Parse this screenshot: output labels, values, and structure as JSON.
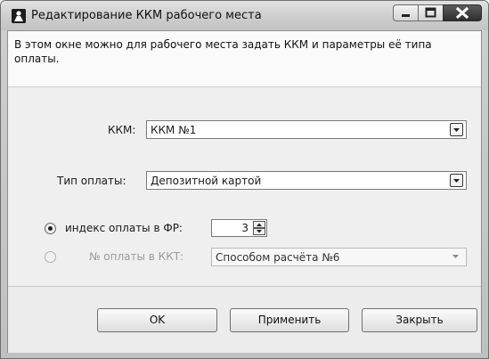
{
  "window": {
    "title": "Редактирование ККМ рабочего места",
    "icon": "app-icon"
  },
  "info": {
    "text": "В этом окне можно для рабочего места задать ККМ и параметры её типа оплаты."
  },
  "form": {
    "kkm_label": "ККМ:",
    "kkm_value": "ККМ №1",
    "payment_type_label": "Тип оплаты:",
    "payment_type_value": "Депозитной картой",
    "radio_index_label": "индекс оплаты в ФР:",
    "radio_index_selected": true,
    "index_value": "3",
    "radio_number_label": "№ оплаты в ККТ:",
    "radio_number_selected": false,
    "number_value": "Способом расчёта №6"
  },
  "buttons": {
    "ok": "OK",
    "apply": "Применить",
    "close": "Закрыть"
  }
}
